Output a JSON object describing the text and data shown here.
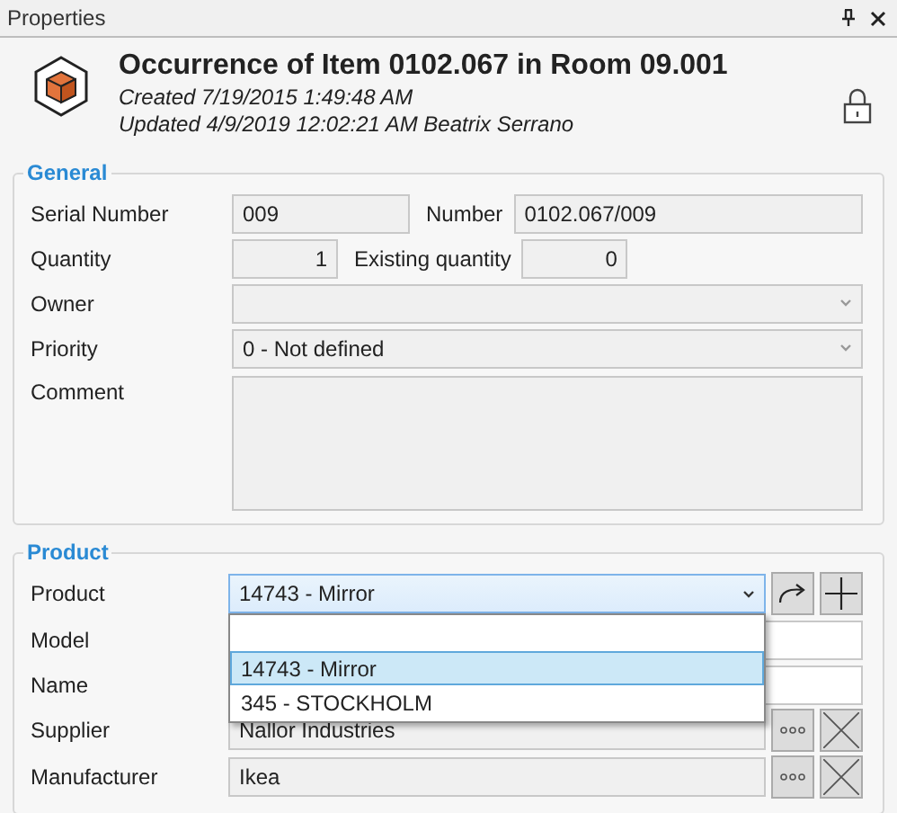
{
  "panel": {
    "title": "Properties"
  },
  "header": {
    "title": "Occurrence of Item 0102.067 in Room 09.001",
    "created": "Created 7/19/2015 1:49:48 AM",
    "updated": "Updated 4/9/2019 12:02:21 AM Beatrix Serrano"
  },
  "general": {
    "legend": "General",
    "serial_number": {
      "label": "Serial Number",
      "value": "009"
    },
    "number": {
      "label": "Number",
      "value": "0102.067/009"
    },
    "quantity": {
      "label": "Quantity",
      "value": "1"
    },
    "existing_quantity": {
      "label": "Existing quantity",
      "value": "0"
    },
    "owner": {
      "label": "Owner"
    },
    "priority": {
      "label": "Priority",
      "value": "0  - Not defined"
    },
    "comment": {
      "label": "Comment"
    }
  },
  "product": {
    "legend": "Product",
    "product": {
      "label": "Product",
      "value": "14743 - Mirror",
      "expanded": true,
      "options": [
        {
          "label": "14743 - Mirror",
          "selected": true
        },
        {
          "label": "345 - STOCKHOLM",
          "selected": false
        }
      ]
    },
    "model": {
      "label": "Model"
    },
    "name": {
      "label": "Name"
    },
    "supplier": {
      "label": "Supplier",
      "value": "Nallor Industries"
    },
    "manufacturer": {
      "label": "Manufacturer",
      "value": "Ikea"
    }
  }
}
